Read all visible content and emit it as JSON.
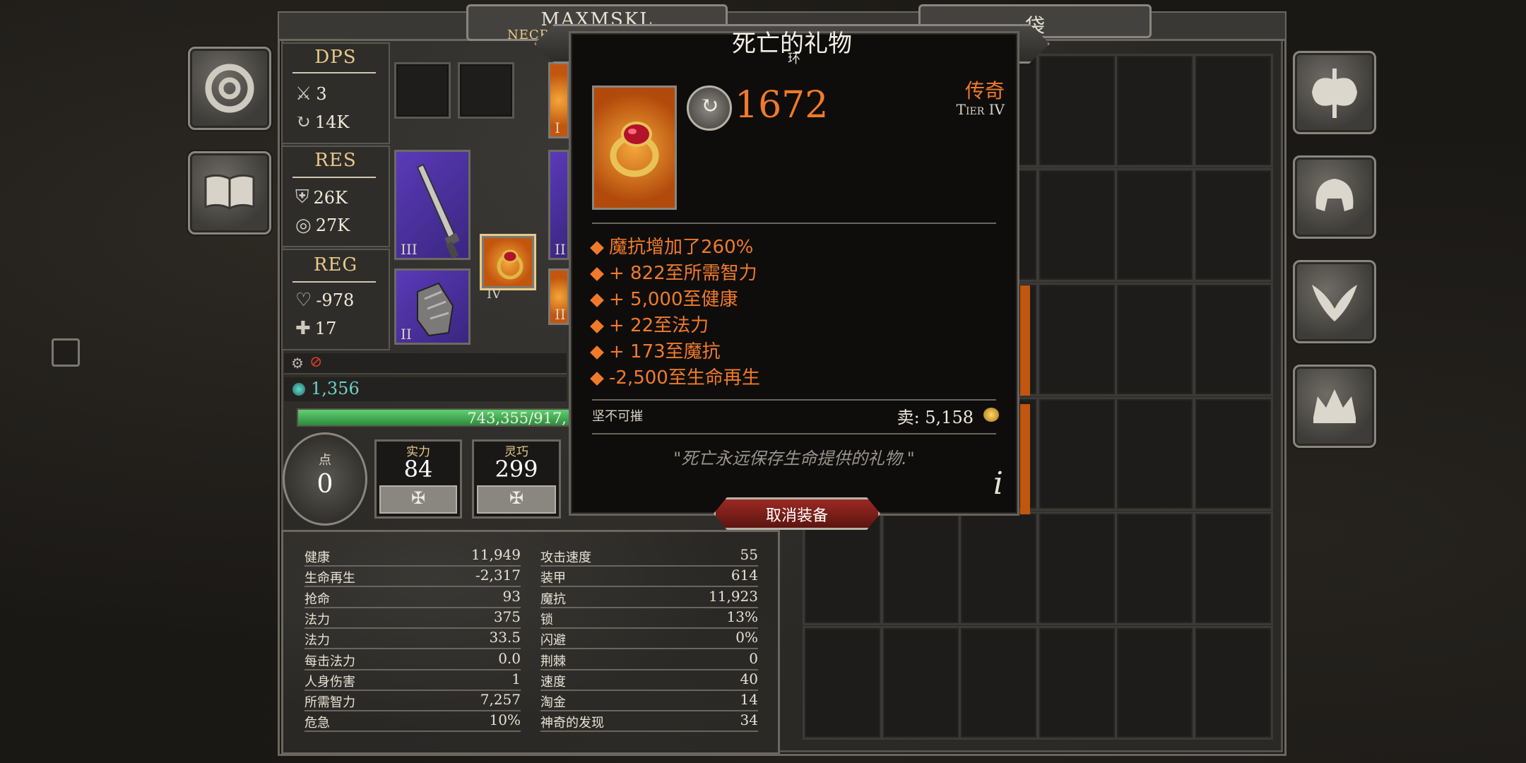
{
  "character": {
    "name": "MAXMSKL",
    "class_partial": "NECROMA"
  },
  "bag_tab": {
    "label": "袋"
  },
  "dps": {
    "title": "DPS",
    "physical": "3",
    "magic": "14K"
  },
  "res": {
    "title": "RES",
    "armor": "26K",
    "magic_res": "27K"
  },
  "reg": {
    "title": "REG",
    "health_regen": "-978",
    "mana_regen": "17"
  },
  "misc": {
    "gold_value": "1,356",
    "xp_bar": "743,355/917,"
  },
  "equip": {
    "dagger_tier": "III",
    "gauntlet_tier": "II",
    "ring_tier": "IV",
    "partial_tiers": [
      "I",
      "II",
      "II"
    ]
  },
  "points": {
    "label": "点",
    "value": "0"
  },
  "attributes": [
    {
      "label": "实力",
      "value": "84"
    },
    {
      "label": "灵巧",
      "value": "299"
    }
  ],
  "tooltip": {
    "title": "死亡的礼物",
    "subtitle": "环",
    "item_power": "1672",
    "rarity": "传奇",
    "tier": "Tier IV",
    "affixes": [
      "魔抗增加了260%",
      "+ 822至所需智力",
      "+ 5,000至健康",
      "+ 22至法力",
      "+ 173至魔抗",
      "-2,500至生命再生"
    ],
    "flag": "坚不可摧",
    "sell_label": "卖: 5,158",
    "flavor": "\"死亡永远保存生命提供的礼物.\"",
    "info_glyph": "i",
    "unequip_label": "取消装备"
  },
  "stats_left": [
    {
      "label": "健康",
      "value": "11,949"
    },
    {
      "label": "生命再生",
      "value": "-2,317"
    },
    {
      "label": "抢命",
      "value": "93"
    },
    {
      "label": "法力",
      "value": "375"
    },
    {
      "label": "法力",
      "value": "33.5"
    },
    {
      "label": "每击法力",
      "value": "0.0"
    },
    {
      "label": "人身伤害",
      "value": "1"
    },
    {
      "label": "所需智力",
      "value": "7,257"
    },
    {
      "label": "危急",
      "value": "10%"
    }
  ],
  "stats_right": [
    {
      "label": "攻击速度",
      "value": "55"
    },
    {
      "label": "装甲",
      "value": "614"
    },
    {
      "label": "魔抗",
      "value": "11,923"
    },
    {
      "label": "锁",
      "value": "13%"
    },
    {
      "label": "闪避",
      "value": "0%"
    },
    {
      "label": "荆棘",
      "value": "0"
    },
    {
      "label": "速度",
      "value": "40"
    },
    {
      "label": "淘金",
      "value": "14"
    },
    {
      "label": "神奇的发现",
      "value": "34"
    }
  ],
  "icons": {
    "left_buttons": [
      "settings-ring-icon",
      "spellbook-icon"
    ],
    "right_buttons": [
      "battle-axe-icon",
      "helmet-icon",
      "wings-icon",
      "crown-icon"
    ]
  },
  "colors": {
    "legendary": "#f07a2a",
    "xp_bar": "#3aa650",
    "gold": "#e8c98a"
  }
}
